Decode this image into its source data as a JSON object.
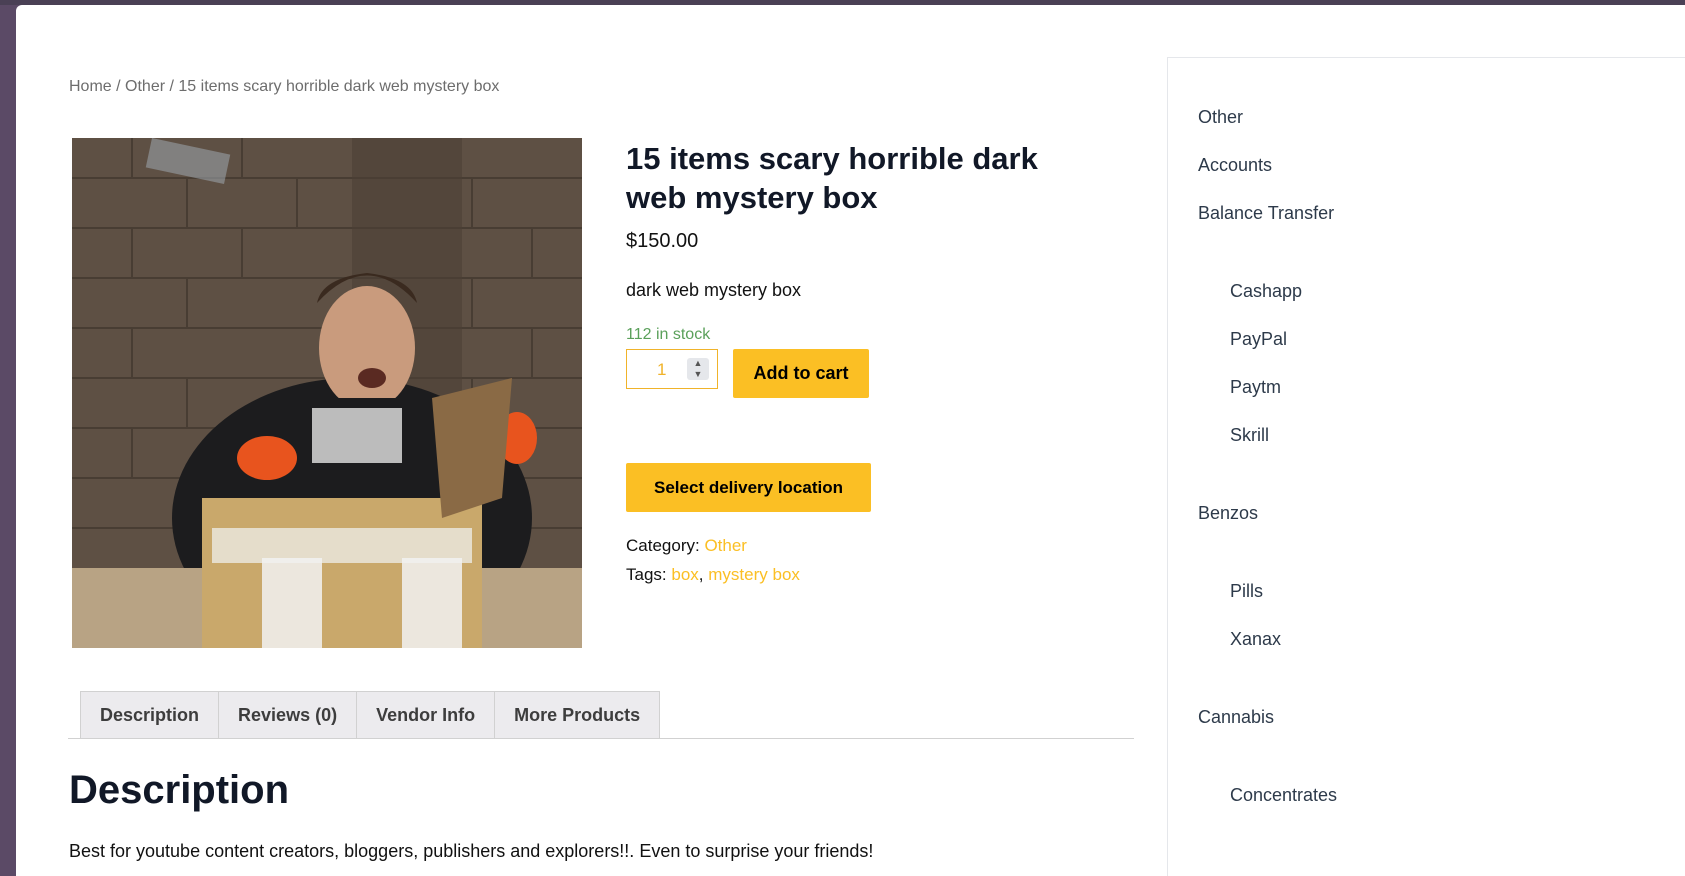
{
  "breadcrumb": {
    "home": "Home",
    "sep1": " / ",
    "category": "Other",
    "sep2": " / ",
    "current": "15 items scary horrible dark web mystery box"
  },
  "product": {
    "title": "15 items scary horrible dark web mystery box",
    "price": "$150.00",
    "short_description": "dark web mystery box",
    "stock": "112 in stock",
    "quantity": "1",
    "add_to_cart": "Add to cart",
    "select_delivery": "Select delivery location",
    "category_label": "Category:",
    "category_value": "Other",
    "tags_label": "Tags:",
    "tags": [
      "box",
      "mystery box"
    ],
    "tag_separator": ","
  },
  "tabs": [
    "Description",
    "Reviews (0)",
    "Vendor Info",
    "More Products"
  ],
  "description": {
    "heading": "Description",
    "text": "Best for youtube content creators, bloggers, publishers and explorers!!. Even to surprise your friends!"
  },
  "sidebar": {
    "categories": [
      {
        "label": "Other",
        "level": "top"
      },
      {
        "label": "Accounts",
        "level": "top"
      },
      {
        "label": "Balance Transfer",
        "level": "top"
      },
      {
        "label": "Cashapp",
        "level": "sub"
      },
      {
        "label": "PayPal",
        "level": "sub"
      },
      {
        "label": "Paytm",
        "level": "sub"
      },
      {
        "label": "Skrill",
        "level": "sub"
      },
      {
        "label": "Benzos",
        "level": "top"
      },
      {
        "label": "Pills",
        "level": "sub"
      },
      {
        "label": "Xanax",
        "level": "sub"
      },
      {
        "label": "Cannabis",
        "level": "top"
      },
      {
        "label": "Concentrates",
        "level": "sub"
      }
    ]
  },
  "colors": {
    "accent": "#fbbf24",
    "stock": "#5aa05a",
    "heading": "#111827"
  }
}
